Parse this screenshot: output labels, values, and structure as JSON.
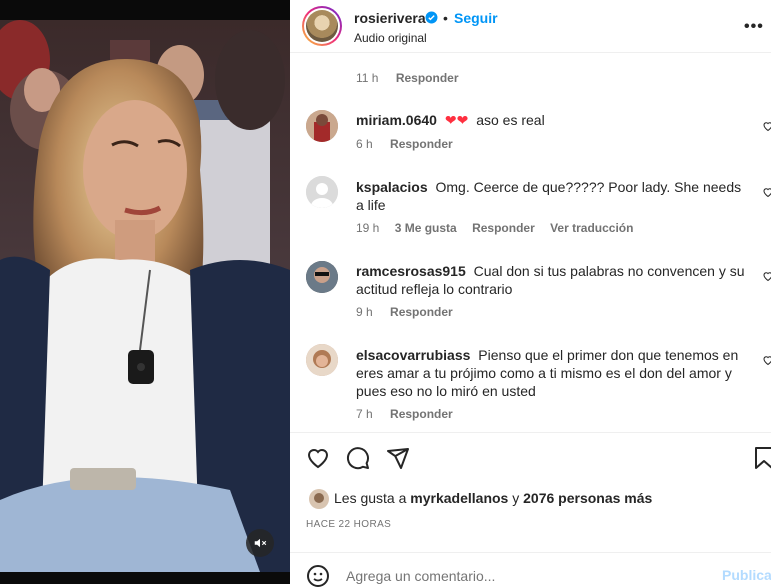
{
  "post": {
    "username": "rosierivera",
    "dot": "•",
    "follow_label": "Seguir",
    "audio_label": "Audio original",
    "more_label": "•••"
  },
  "first_meta": {
    "time": "11 h",
    "reply": "Responder"
  },
  "comments": [
    {
      "user": "miriam.0640",
      "text": "aso es real",
      "emoji": "heart-emoji",
      "time": "6 h",
      "reply": "Responder"
    },
    {
      "user": "kspalacios",
      "text": "Omg. Ceerce de que????? Poor lady. She needs a life",
      "time": "19 h",
      "likes": "3 Me gusta",
      "reply": "Responder",
      "translate": "Ver traducción"
    },
    {
      "user": "ramcesrosas915",
      "text": "Cual don si tus palabras no convencen y su actitud refleja lo contrario",
      "time": "9 h",
      "reply": "Responder"
    },
    {
      "user": "elsacovarrubiass",
      "text": "Pienso que el primer don que tenemos en eres amar a tu prójimo como a ti mismo es el don del amor y pues eso no lo miró en usted",
      "time": "7 h",
      "reply": "Responder"
    }
  ],
  "likes": {
    "prefix": "Les gusta a",
    "user": "myrkadellanos",
    "connector": "y",
    "rest": "2076 personas más"
  },
  "posted_ago": "HACE 22 HORAS",
  "composer": {
    "placeholder": "Agrega un comentario...",
    "publish_label": "Publicar"
  },
  "colors": {
    "accent": "#0095f6",
    "heart": "#ff3040",
    "muted": "#737373"
  }
}
